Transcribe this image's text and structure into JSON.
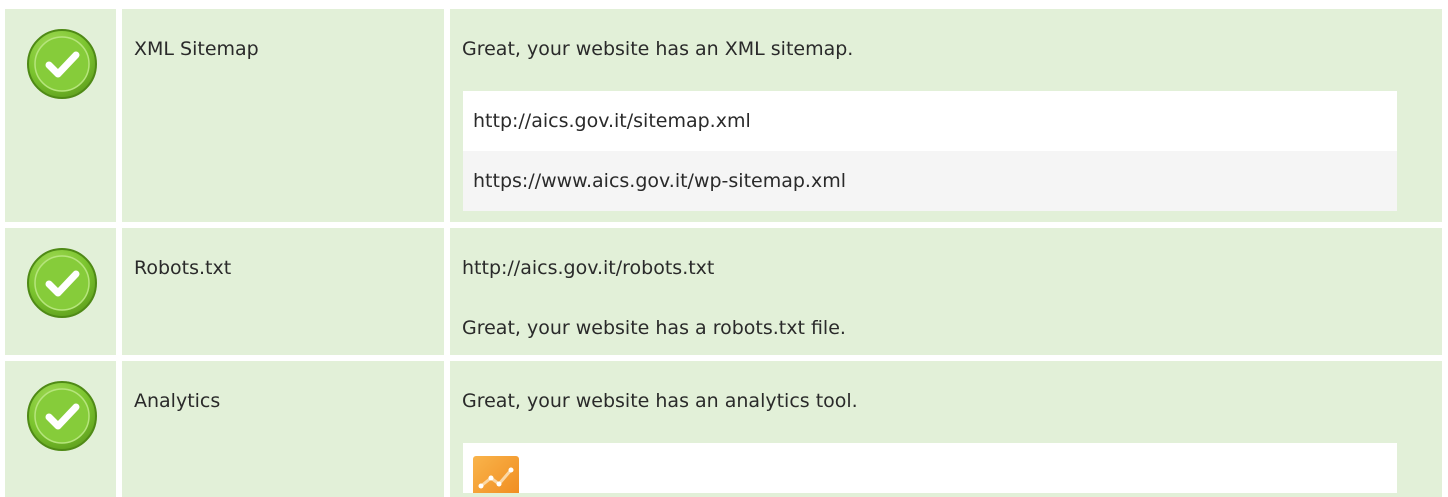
{
  "rows": [
    {
      "name": "XML Sitemap",
      "status": "pass",
      "status_icon": "checkmark-circle-icon",
      "message": "Great, your website has an XML sitemap.",
      "urls": [
        "http://aics.gov.it/sitemap.xml",
        "https://www.aics.gov.it/wp-sitemap.xml"
      ]
    },
    {
      "name": "Robots.txt",
      "status": "pass",
      "status_icon": "checkmark-circle-icon",
      "url": "http://aics.gov.it/robots.txt",
      "message": "Great, your website has a robots.txt file."
    },
    {
      "name": "Analytics",
      "status": "pass",
      "status_icon": "checkmark-circle-icon",
      "message": "Great, your website has an analytics tool.",
      "tools": [
        {
          "icon": "google-analytics-logo-icon"
        }
      ]
    }
  ],
  "colors": {
    "row_background": "#e2f0d8",
    "check_badge": "#7cc52f",
    "check_badge_border": "#5f9c1e",
    "check_mark": "#ffffff",
    "analytics_logo": "#f5a623"
  }
}
